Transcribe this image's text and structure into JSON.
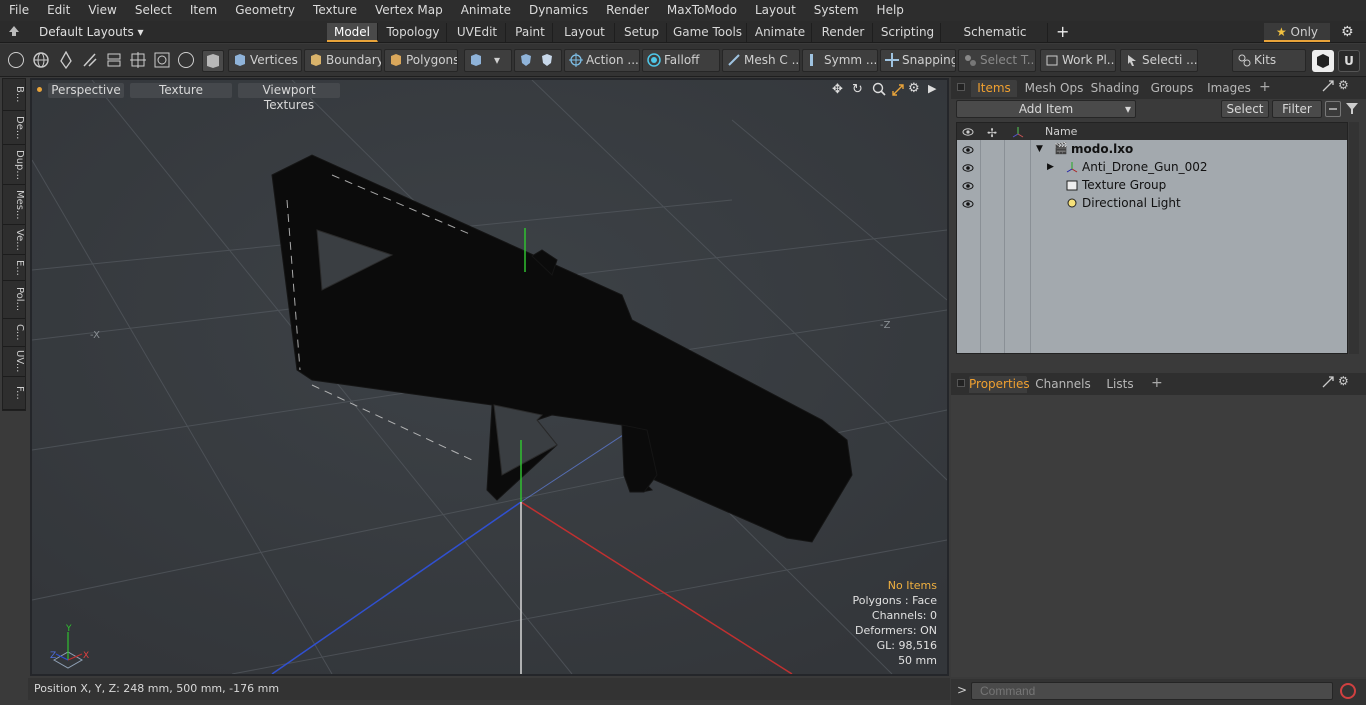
{
  "menu": [
    "File",
    "Edit",
    "View",
    "Select",
    "Item",
    "Geometry",
    "Texture",
    "Vertex Map",
    "Animate",
    "Dynamics",
    "Render",
    "MaxToModo",
    "Layout",
    "System",
    "Help"
  ],
  "layout_selector": "Default Layouts",
  "layout_tabs": [
    "Model",
    "Topology",
    "UVEdit",
    "Paint",
    "Layout",
    "Setup",
    "Game Tools",
    "Animate",
    "Render",
    "Scripting",
    "Schematic Fusion"
  ],
  "active_layout_tab": "Model",
  "only_label": "Only",
  "toolbar": {
    "vertices": "Vertices",
    "boundary": "Boundary",
    "polygons": "Polygons",
    "action": "Action ...",
    "falloff": "Falloff",
    "mesh_c": "Mesh C ...",
    "symm": "Symm ...",
    "snapping": "Snapping",
    "select_t": "Select T...",
    "work_pl": "Work Pl...",
    "selecti": "Selecti ...",
    "kits": "Kits"
  },
  "left_tabs": [
    "B...",
    "De...",
    "Dup...",
    "Mes...",
    "Ve...",
    "E...",
    "Pol...",
    "C...",
    "UV...",
    "F..."
  ],
  "viewport": {
    "perspective": "Perspective",
    "texture": "Texture",
    "viewport_textures": "Viewport Textures",
    "axis_x_label": "-X",
    "axis_z_label": "-Z",
    "info": {
      "no_items": "No Items",
      "polygons": "Polygons : Face",
      "channels": "Channels: 0",
      "deformers": "Deformers: ON",
      "gl": "GL: 98,516",
      "scale": "50 mm"
    },
    "gizmo_y": "Y",
    "gizmo_x": "X",
    "gizmo_z": "Z"
  },
  "status": "Position X, Y, Z:   248 mm, 500 mm, -176 mm",
  "items_panel": {
    "tabs": [
      "Items",
      "Mesh Ops",
      "Shading",
      "Groups",
      "Images"
    ],
    "active_tab": "Items",
    "add_item": "Add Item",
    "select": "Select",
    "filter": "Filter",
    "column_name": "Name",
    "rows": [
      {
        "label": "modo.lxo",
        "indent": 0
      },
      {
        "label": "Anti_Drone_Gun_002",
        "indent": 1
      },
      {
        "label": "Texture Group",
        "indent": 1
      },
      {
        "label": "Directional Light",
        "indent": 1
      }
    ]
  },
  "properties_panel": {
    "tabs": [
      "Properties",
      "Channels",
      "Lists"
    ],
    "active_tab": "Properties"
  },
  "command_placeholder": "Command",
  "colors": {
    "accent": "#e8a33a",
    "axis_x": "#c03030",
    "axis_y": "#30c030",
    "axis_z": "#3050d0",
    "list_bg": "#a3a9ae"
  }
}
